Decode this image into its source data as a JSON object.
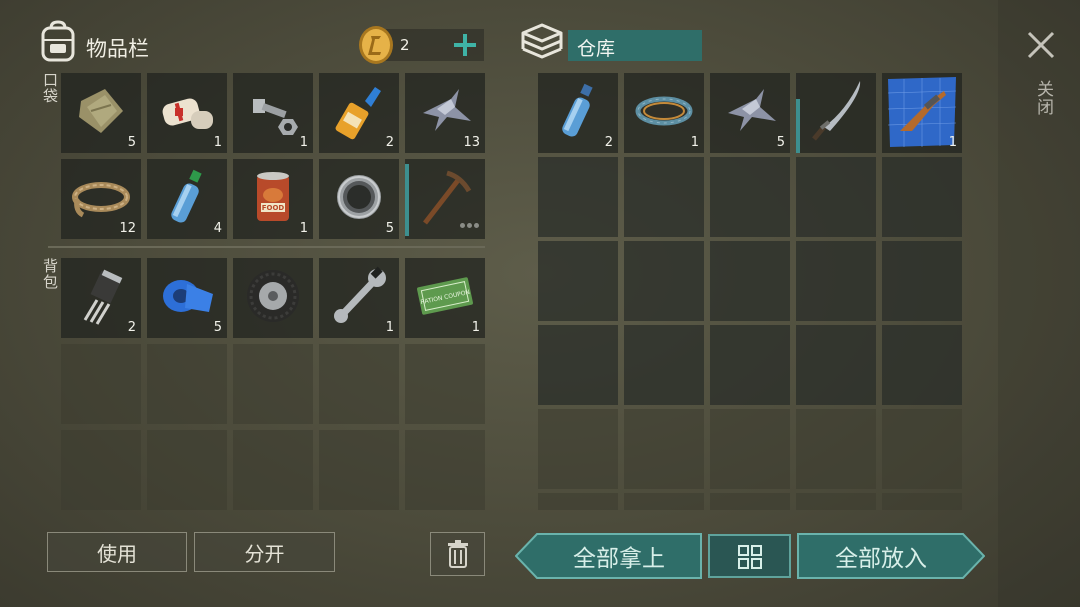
{
  "inventory": {
    "title": "物品栏",
    "coins": "2",
    "pocket_label": "口袋",
    "backpack_label": "背包",
    "pocket_items": [
      {
        "name": "cloth",
        "qty": "5"
      },
      {
        "name": "bandage",
        "qty": "1"
      },
      {
        "name": "bolt-nut",
        "qty": "1"
      },
      {
        "name": "glue",
        "qty": "2"
      },
      {
        "name": "metal-scrap",
        "qty": "13"
      },
      {
        "name": "rope",
        "qty": "12"
      },
      {
        "name": "water-bottle",
        "qty": "4"
      },
      {
        "name": "canned-food",
        "qty": "1"
      },
      {
        "name": "bearing",
        "qty": "5"
      },
      {
        "name": "pickaxe",
        "qty": ""
      }
    ],
    "backpack_items": [
      {
        "name": "transistor",
        "qty": "2"
      },
      {
        "name": "duct-tape",
        "qty": "5"
      },
      {
        "name": "tire",
        "qty": ""
      },
      {
        "name": "wrench",
        "qty": "1"
      },
      {
        "name": "ration-coupon",
        "qty": "1"
      }
    ],
    "can_label": "FOOD",
    "coupon_text": "RATION COUPON"
  },
  "storage": {
    "title": "仓库",
    "items": [
      {
        "name": "water-bottle",
        "qty": "2"
      },
      {
        "name": "wire",
        "qty": "1"
      },
      {
        "name": "metal-scrap",
        "qty": "5"
      },
      {
        "name": "machete",
        "qty": ""
      },
      {
        "name": "rifle-blueprint",
        "qty": "1"
      }
    ]
  },
  "actions": {
    "use": "使用",
    "split": "分开",
    "take_all": "全部拿上",
    "put_all": "全部放入"
  },
  "close_label": "关闭",
  "colors": {
    "accent": "#3d8f8f",
    "button_teal": "#2f6e69",
    "background": "#4e4d3d"
  }
}
